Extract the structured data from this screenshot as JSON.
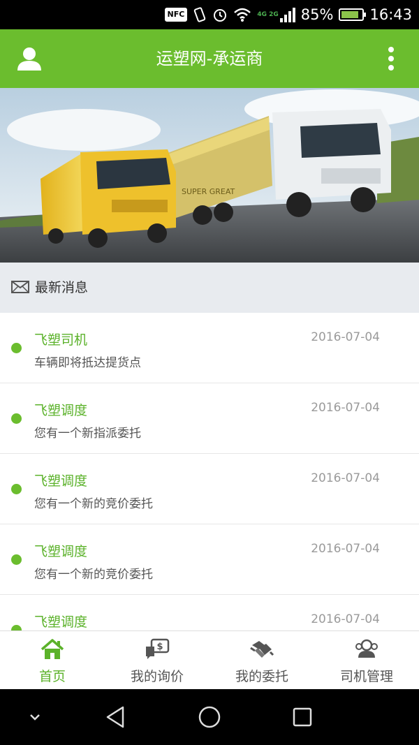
{
  "status_bar": {
    "nfc_label": "NFC",
    "network": "4G 2G",
    "battery": "85%",
    "battery_level": 0.85,
    "time": "16:43"
  },
  "header": {
    "title": "运塑网-承运商",
    "left_icon": "user-icon",
    "right_icon": "more-vertical-icon",
    "color": "#6bbd2e"
  },
  "banner": {
    "icon": "trucks-banner-image",
    "truck_brand_text": "SUPER GREAT"
  },
  "section": {
    "title": "最新消息",
    "icon": "envelope-icon"
  },
  "messages": [
    {
      "sender": "飞塑司机",
      "date": "2016-07-04",
      "text": "车辆即将抵达提货点"
    },
    {
      "sender": "飞塑调度",
      "date": "2016-07-04",
      "text": "您有一个新指派委托"
    },
    {
      "sender": "飞塑调度",
      "date": "2016-07-04",
      "text": "您有一个新的竞价委托"
    },
    {
      "sender": "飞塑调度",
      "date": "2016-07-04",
      "text": "您有一个新的竞价委托"
    },
    {
      "sender": "飞塑调度",
      "date": "2016-07-04",
      "text": ""
    }
  ],
  "tabs": [
    {
      "label": "首页",
      "icon": "home-icon",
      "active": true
    },
    {
      "label": "我的询价",
      "icon": "price-inquiry-icon",
      "active": false
    },
    {
      "label": "我的委托",
      "icon": "handshake-icon",
      "active": false
    },
    {
      "label": "司机管理",
      "icon": "drivers-icon",
      "active": false
    }
  ],
  "colors": {
    "accent": "#6bbd2e",
    "accent_text": "#5bb22a",
    "section_bg": "#e8ebef"
  }
}
